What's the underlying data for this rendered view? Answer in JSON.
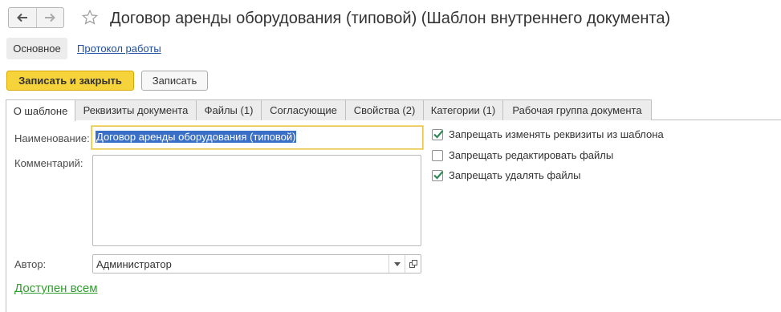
{
  "window": {
    "title": "Договор аренды оборудования (типовой) (Шаблон внутреннего документа)"
  },
  "sections": {
    "main": "Основное",
    "log": "Протокол работы"
  },
  "commands": {
    "save_close": "Записать и закрыть",
    "save": "Записать"
  },
  "tabs": [
    {
      "label": "О шаблоне",
      "active": true
    },
    {
      "label": "Реквизиты документа"
    },
    {
      "label": "Файлы (1)"
    },
    {
      "label": "Согласующие"
    },
    {
      "label": "Свойства (2)"
    },
    {
      "label": "Категории (1)"
    },
    {
      "label": "Рабочая группа документа"
    }
  ],
  "form": {
    "name_label": "Наименование:",
    "name_value": "Договор аренды оборудования (типовой)",
    "comment_label": "Комментарий:",
    "comment_value": "",
    "author_label": "Автор:",
    "author_value": "Администратор",
    "access_link": "Доступен всем"
  },
  "options": [
    {
      "label": "Запрещать изменять реквизиты из шаблона",
      "checked": true
    },
    {
      "label": "Запрещать редактировать файлы",
      "checked": false
    },
    {
      "label": "Запрещать удалять файлы",
      "checked": true
    }
  ],
  "colors": {
    "accent_button": "#f6d33a",
    "link": "#1f4ea1",
    "access_link": "#2f9e2f",
    "check": "#2e8b57"
  },
  "icons": [
    "back-arrow-icon",
    "forward-arrow-icon",
    "star-icon",
    "dropdown-icon",
    "open-form-icon",
    "checkmark-icon"
  ]
}
